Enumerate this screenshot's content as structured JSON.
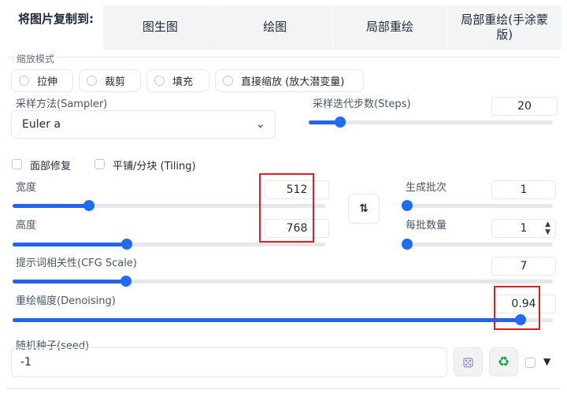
{
  "copy_to": {
    "label": "将图片复制到:",
    "tabs": [
      "图生图",
      "绘图",
      "局部重绘",
      "局部重绘(手涂蒙版)"
    ]
  },
  "resize_mode": {
    "legend": "缩放模式",
    "options": [
      "拉伸",
      "裁剪",
      "填充",
      "直接缩放 (放大潜变量)"
    ]
  },
  "sampler": {
    "label": "采样方法(Sampler)",
    "value": "Euler a"
  },
  "steps": {
    "label": "采样迭代步数(Steps)",
    "value": "20",
    "fraction": 0.13
  },
  "checkboxes": {
    "face_restore": "面部修复",
    "tiling": "平铺/分块 (Tiling)"
  },
  "width": {
    "label": "宽度",
    "value": "512",
    "fraction": 0.245
  },
  "height": {
    "label": "高度",
    "value": "768",
    "fraction": 0.365
  },
  "swap_icon": "swap-vertical-icon",
  "batch_count": {
    "label": "生成批次",
    "value": "1",
    "fraction": 0.0
  },
  "batch_size": {
    "label": "每批数量",
    "value": "1",
    "fraction": 0.0
  },
  "cfg_scale": {
    "label": "提示词相关性(CFG Scale)",
    "value": "7",
    "fraction": 0.21
  },
  "denoising": {
    "label": "重绘幅度(Denoising)",
    "value": "0.94",
    "fraction": 0.94
  },
  "seed": {
    "label": "随机种子(seed)",
    "value": "-1"
  },
  "colors": {
    "accent": "#2563eb",
    "highlight": "#e11d1d"
  }
}
